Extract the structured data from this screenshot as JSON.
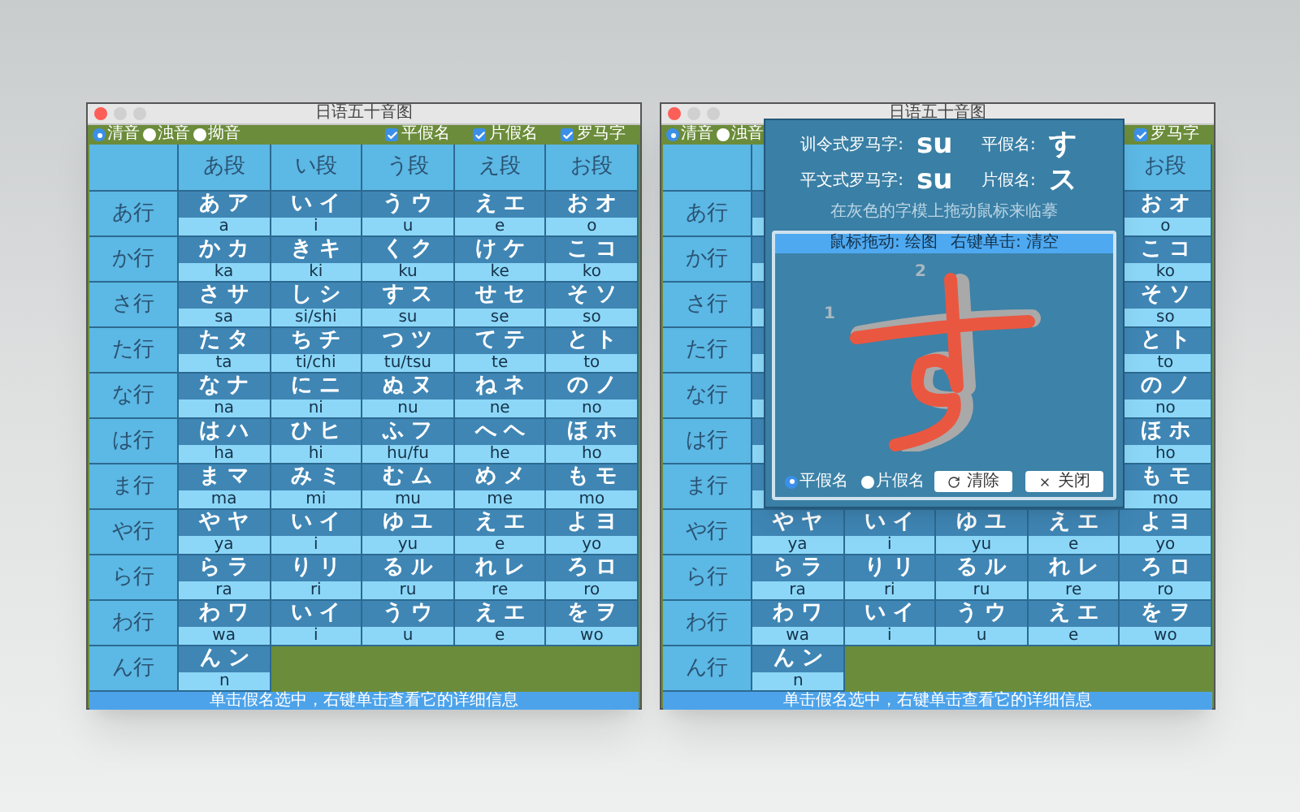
{
  "windows": [
    {
      "title": "日语五十音图",
      "radios": [
        {
          "label": "清音",
          "selected": true
        },
        {
          "label": "浊音",
          "selected": false
        },
        {
          "label": "拗音",
          "selected": false
        }
      ],
      "checkboxes": [
        {
          "label": "平假名",
          "checked": true
        },
        {
          "label": "片假名",
          "checked": true
        },
        {
          "label": "罗马字",
          "checked": true
        }
      ],
      "table": {
        "columns": [
          "あ段",
          "い段",
          "う段",
          "え段",
          "お段"
        ],
        "rows": [
          {
            "header": "あ行",
            "cells": [
              {
                "kana": "あ ア",
                "romaji": "a"
              },
              {
                "kana": "い イ",
                "romaji": "i"
              },
              {
                "kana": "う ウ",
                "romaji": "u"
              },
              {
                "kana": "え エ",
                "romaji": "e"
              },
              {
                "kana": "お オ",
                "romaji": "o"
              }
            ]
          },
          {
            "header": "か行",
            "cells": [
              {
                "kana": "か カ",
                "romaji": "ka"
              },
              {
                "kana": "き キ",
                "romaji": "ki"
              },
              {
                "kana": "く ク",
                "romaji": "ku"
              },
              {
                "kana": "け ケ",
                "romaji": "ke"
              },
              {
                "kana": "こ コ",
                "romaji": "ko"
              }
            ]
          },
          {
            "header": "さ行",
            "cells": [
              {
                "kana": "さ サ",
                "romaji": "sa"
              },
              {
                "kana": "し シ",
                "romaji": "si/shi"
              },
              {
                "kana": "す ス",
                "romaji": "su"
              },
              {
                "kana": "せ セ",
                "romaji": "se"
              },
              {
                "kana": "そ ソ",
                "romaji": "so"
              }
            ]
          },
          {
            "header": "た行",
            "cells": [
              {
                "kana": "た タ",
                "romaji": "ta"
              },
              {
                "kana": "ち チ",
                "romaji": "ti/chi"
              },
              {
                "kana": "つ ツ",
                "romaji": "tu/tsu"
              },
              {
                "kana": "て テ",
                "romaji": "te"
              },
              {
                "kana": "と ト",
                "romaji": "to"
              }
            ]
          },
          {
            "header": "な行",
            "cells": [
              {
                "kana": "な ナ",
                "romaji": "na"
              },
              {
                "kana": "に ニ",
                "romaji": "ni"
              },
              {
                "kana": "ぬ ヌ",
                "romaji": "nu"
              },
              {
                "kana": "ね ネ",
                "romaji": "ne"
              },
              {
                "kana": "の ノ",
                "romaji": "no"
              }
            ]
          },
          {
            "header": "は行",
            "cells": [
              {
                "kana": "は ハ",
                "romaji": "ha"
              },
              {
                "kana": "ひ ヒ",
                "romaji": "hi"
              },
              {
                "kana": "ふ フ",
                "romaji": "hu/fu"
              },
              {
                "kana": "へ ヘ",
                "romaji": "he"
              },
              {
                "kana": "ほ ホ",
                "romaji": "ho"
              }
            ]
          },
          {
            "header": "ま行",
            "cells": [
              {
                "kana": "ま マ",
                "romaji": "ma"
              },
              {
                "kana": "み ミ",
                "romaji": "mi"
              },
              {
                "kana": "む ム",
                "romaji": "mu"
              },
              {
                "kana": "め メ",
                "romaji": "me"
              },
              {
                "kana": "も モ",
                "romaji": "mo"
              }
            ]
          },
          {
            "header": "や行",
            "cells": [
              {
                "kana": "や ヤ",
                "romaji": "ya"
              },
              {
                "kana": "い イ",
                "romaji": "i"
              },
              {
                "kana": "ゆ ユ",
                "romaji": "yu"
              },
              {
                "kana": "え エ",
                "romaji": "e"
              },
              {
                "kana": "よ ヨ",
                "romaji": "yo"
              }
            ]
          },
          {
            "header": "ら行",
            "cells": [
              {
                "kana": "ら ラ",
                "romaji": "ra"
              },
              {
                "kana": "り リ",
                "romaji": "ri"
              },
              {
                "kana": "る ル",
                "romaji": "ru"
              },
              {
                "kana": "れ レ",
                "romaji": "re"
              },
              {
                "kana": "ろ ロ",
                "romaji": "ro"
              }
            ]
          },
          {
            "header": "わ行",
            "cells": [
              {
                "kana": "わ ワ",
                "romaji": "wa"
              },
              {
                "kana": "い イ",
                "romaji": "i"
              },
              {
                "kana": "う ウ",
                "romaji": "u"
              },
              {
                "kana": "え エ",
                "romaji": "e"
              },
              {
                "kana": "を ヲ",
                "romaji": "wo"
              }
            ]
          },
          {
            "header": "ん行",
            "cells": [
              {
                "kana": "ん ン",
                "romaji": "n"
              }
            ]
          }
        ]
      },
      "status_bar": "单击假名选中，右键单击查看它的详细信息"
    },
    {
      "title": "日语五十音图",
      "radios": [
        {
          "label": "清音",
          "selected": true
        },
        {
          "label": "浊音",
          "selected": false
        }
      ],
      "checkboxes": [
        {
          "label": "罗马字",
          "checked": true
        }
      ],
      "table": {
        "columns": [
          null,
          null,
          null,
          null,
          "お段"
        ],
        "rows": [
          {
            "header": "あ行",
            "cells": [
              null,
              null,
              null,
              null,
              {
                "kana": "お オ",
                "romaji": "o"
              }
            ]
          },
          {
            "header": "か行",
            "cells": [
              null,
              null,
              null,
              null,
              {
                "kana": "こ コ",
                "romaji": "ko"
              }
            ]
          },
          {
            "header": "さ行",
            "cells": [
              null,
              null,
              null,
              null,
              {
                "kana": "そ ソ",
                "romaji": "so"
              }
            ]
          },
          {
            "header": "た行",
            "cells": [
              null,
              null,
              null,
              null,
              {
                "kana": "と ト",
                "romaji": "to"
              }
            ]
          },
          {
            "header": "な行",
            "cells": [
              null,
              null,
              null,
              null,
              {
                "kana": "の ノ",
                "romaji": "no"
              }
            ]
          },
          {
            "header": "は行",
            "cells": [
              null,
              null,
              null,
              null,
              {
                "kana": "ほ ホ",
                "romaji": "ho"
              }
            ]
          },
          {
            "header": "ま行",
            "cells": [
              null,
              null,
              null,
              null,
              {
                "kana": "も モ",
                "romaji": "mo"
              }
            ]
          },
          {
            "header": "や行",
            "cells": [
              {
                "kana": "や ヤ",
                "romaji": "ya"
              },
              {
                "kana": "い イ",
                "romaji": "i"
              },
              {
                "kana": "ゆ ユ",
                "romaji": "yu"
              },
              {
                "kana": "え エ",
                "romaji": "e"
              },
              {
                "kana": "よ ヨ",
                "romaji": "yo"
              }
            ]
          },
          {
            "header": "ら行",
            "cells": [
              {
                "kana": "ら ラ",
                "romaji": "ra"
              },
              {
                "kana": "り リ",
                "romaji": "ri"
              },
              {
                "kana": "る ル",
                "romaji": "ru"
              },
              {
                "kana": "れ レ",
                "romaji": "re"
              },
              {
                "kana": "ろ ロ",
                "romaji": "ro"
              }
            ]
          },
          {
            "header": "わ行",
            "cells": [
              {
                "kana": "わ ワ",
                "romaji": "wa"
              },
              {
                "kana": "い イ",
                "romaji": "i"
              },
              {
                "kana": "う ウ",
                "romaji": "u"
              },
              {
                "kana": "え エ",
                "romaji": "e"
              },
              {
                "kana": "を ヲ",
                "romaji": "wo"
              }
            ]
          },
          {
            "header": "ん行",
            "cells": [
              {
                "kana": "ん ン",
                "romaji": "n"
              }
            ]
          }
        ]
      },
      "status_bar": "单击假名选中，右键单击查看它的详细信息",
      "popup": {
        "fields": [
          {
            "label": "训令式罗马字:",
            "value": "su"
          },
          {
            "label": "平假名:",
            "value": "す"
          },
          {
            "label": "平文式罗马字:",
            "value": "su"
          },
          {
            "label": "片假名:",
            "value": "ス"
          }
        ],
        "hint": "在灰色的字模上拖动鼠标来临摹",
        "canvas": {
          "header": [
            "鼠标拖动: 绘图",
            "右键单击: 清空"
          ],
          "stroke_numbers": [
            "1",
            "2"
          ]
        },
        "radios": [
          {
            "label": "平假名",
            "selected": true
          },
          {
            "label": "片假名",
            "selected": false
          }
        ],
        "buttons": [
          {
            "label": "清除",
            "kind": "clear"
          },
          {
            "label": "关闭",
            "kind": "close"
          }
        ]
      }
    }
  ]
}
